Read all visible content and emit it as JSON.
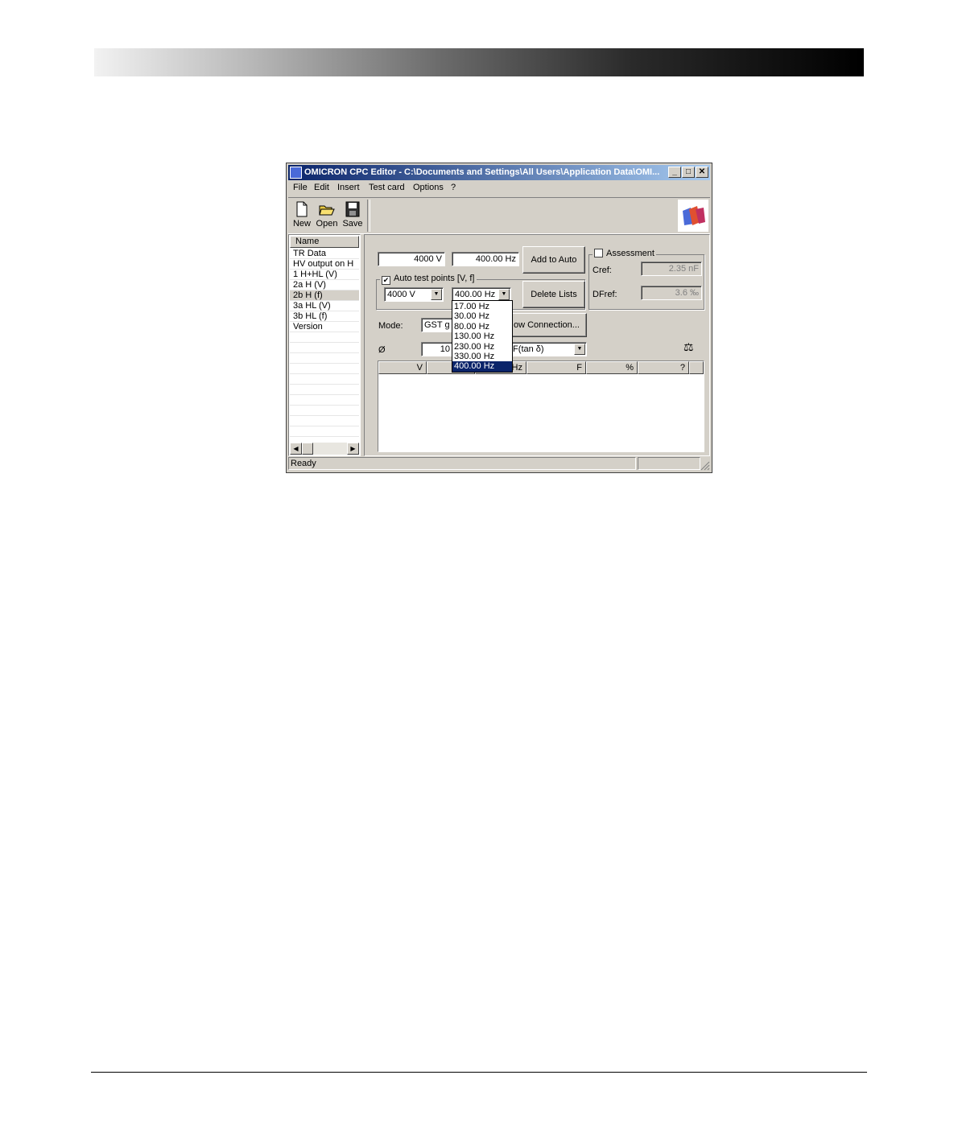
{
  "window": {
    "title": "OMICRON CPC Editor - C:\\Documents and Settings\\All Users\\Application Data\\OMI...",
    "controls": {
      "minimize": "_",
      "maximize": "□",
      "close": "✕"
    }
  },
  "menu": [
    "File",
    "Edit",
    "Insert",
    "Test card",
    "Options",
    "?"
  ],
  "toolbar": {
    "new": "New",
    "open": "Open",
    "save": "Save"
  },
  "tree": {
    "header": "Name",
    "items": [
      "TR Data",
      "HV output on H",
      "1 H+HL (V)",
      "2a H (V)",
      "2b H (f)",
      "3a HL (V)",
      "3b HL (f)",
      "Version"
    ],
    "selected_index": 4
  },
  "main": {
    "voltage_value": "4000 V",
    "frequency_value": "400.00 Hz",
    "add_to_auto": "Add to Auto",
    "auto_group_title": "Auto test points [V, f]",
    "auto_checked": true,
    "auto_voltage_select": "4000 V",
    "auto_frequency_select": "400.00 Hz",
    "delete_lists": "Delete Lists",
    "assessment_title": "Assessment",
    "cref_label": "Cref:",
    "cref_value": "2.35 nF",
    "dfref_label": "DFref:",
    "dfref_value": "3.6 ‰",
    "mode_label": "Mode:",
    "mode_value": "GST g",
    "show_connection": "ow Connection...",
    "avg_label": "Ø",
    "avg_value": "10",
    "measure_select": ", DF(tan δ)",
    "balance_icon": "⚖",
    "table_headers": [
      "V",
      "",
      "Hz",
      "F",
      "%",
      "?"
    ]
  },
  "frequency_dropdown": {
    "options": [
      "17.00 Hz",
      "30.00 Hz",
      "80.00 Hz",
      "130.00 Hz",
      "230.00 Hz",
      "330.00 Hz",
      "400.00 Hz"
    ],
    "selected_index": 6
  },
  "status": {
    "text": "Ready"
  }
}
